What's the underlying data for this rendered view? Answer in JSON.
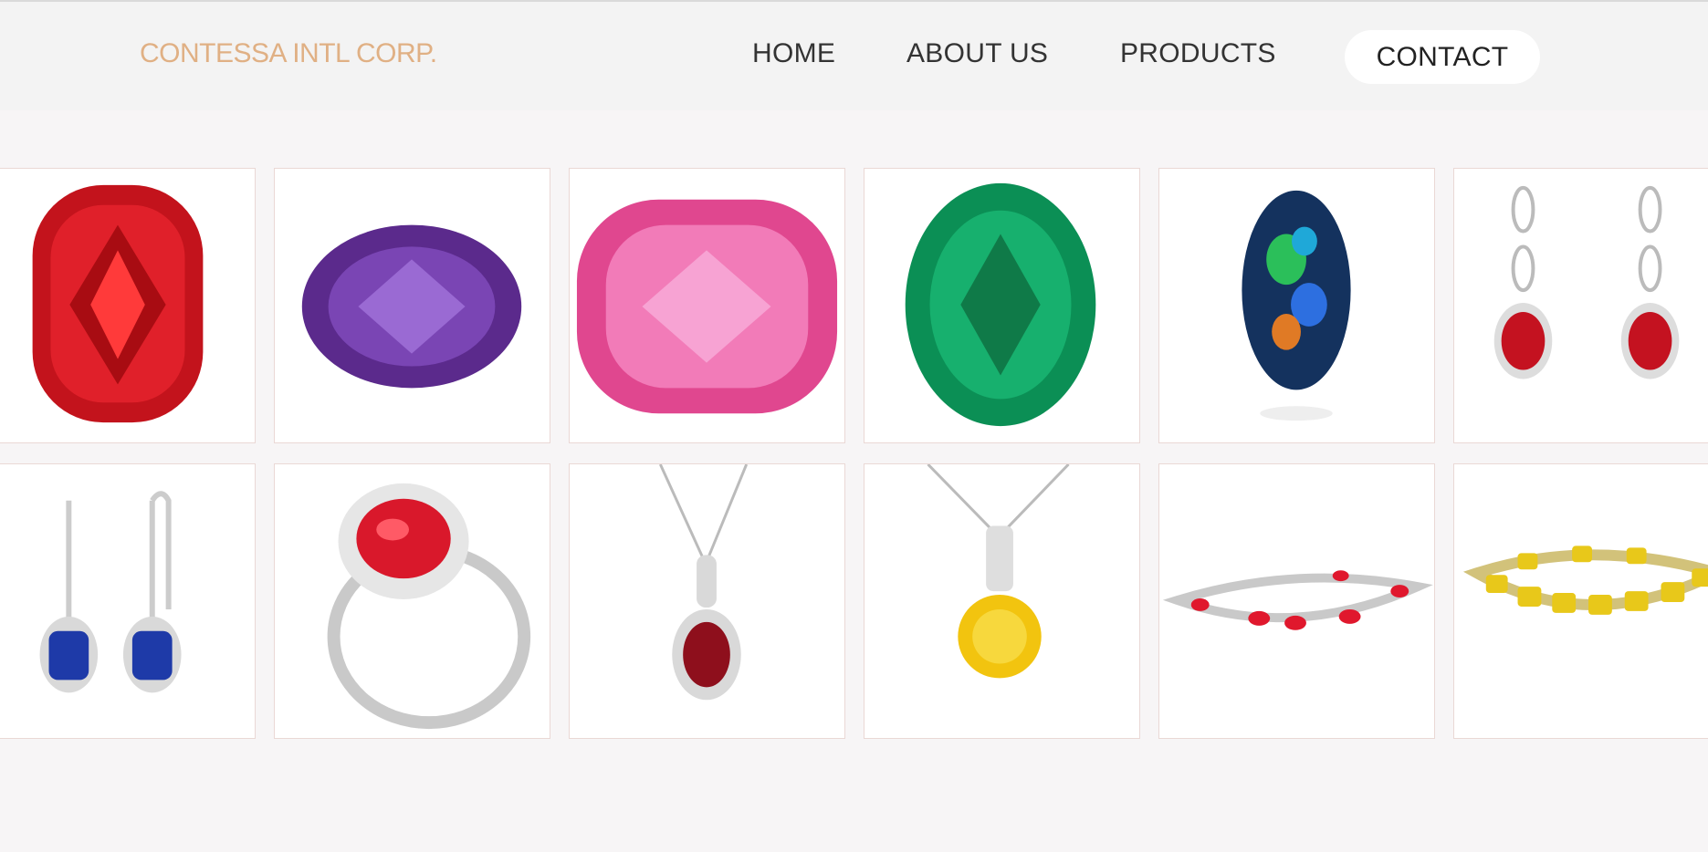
{
  "header": {
    "brand": "CONTESSA INTL CORP.",
    "nav": [
      {
        "label": "HOME"
      },
      {
        "label": "ABOUT US"
      },
      {
        "label": "PRODUCTS"
      },
      {
        "label": "CONTACT"
      }
    ]
  },
  "colors": {
    "brand": "#e0b084",
    "nav_text": "#333333",
    "header_bg": "#f3f3f3",
    "page_bg": "#f7f5f6",
    "tile_border": "#ead8d5"
  },
  "gallery": {
    "rows": [
      [
        {
          "item": "red-ruby-cushion-stone"
        },
        {
          "item": "purple-amethyst-oval-stone"
        },
        {
          "item": "pink-sapphire-cushion-stone"
        },
        {
          "item": "green-emerald-oval-stone"
        },
        {
          "item": "black-opal-oval-stone"
        },
        {
          "item": "ruby-drop-earrings"
        }
      ],
      [
        {
          "item": "blue-sapphire-drop-earrings"
        },
        {
          "item": "ruby-halo-ring"
        },
        {
          "item": "ruby-halo-pendant-necklace"
        },
        {
          "item": "yellow-sapphire-pendant-necklace"
        },
        {
          "item": "ruby-diamond-bracelet"
        },
        {
          "item": "yellow-sapphire-tennis-bracelet"
        }
      ]
    ]
  }
}
